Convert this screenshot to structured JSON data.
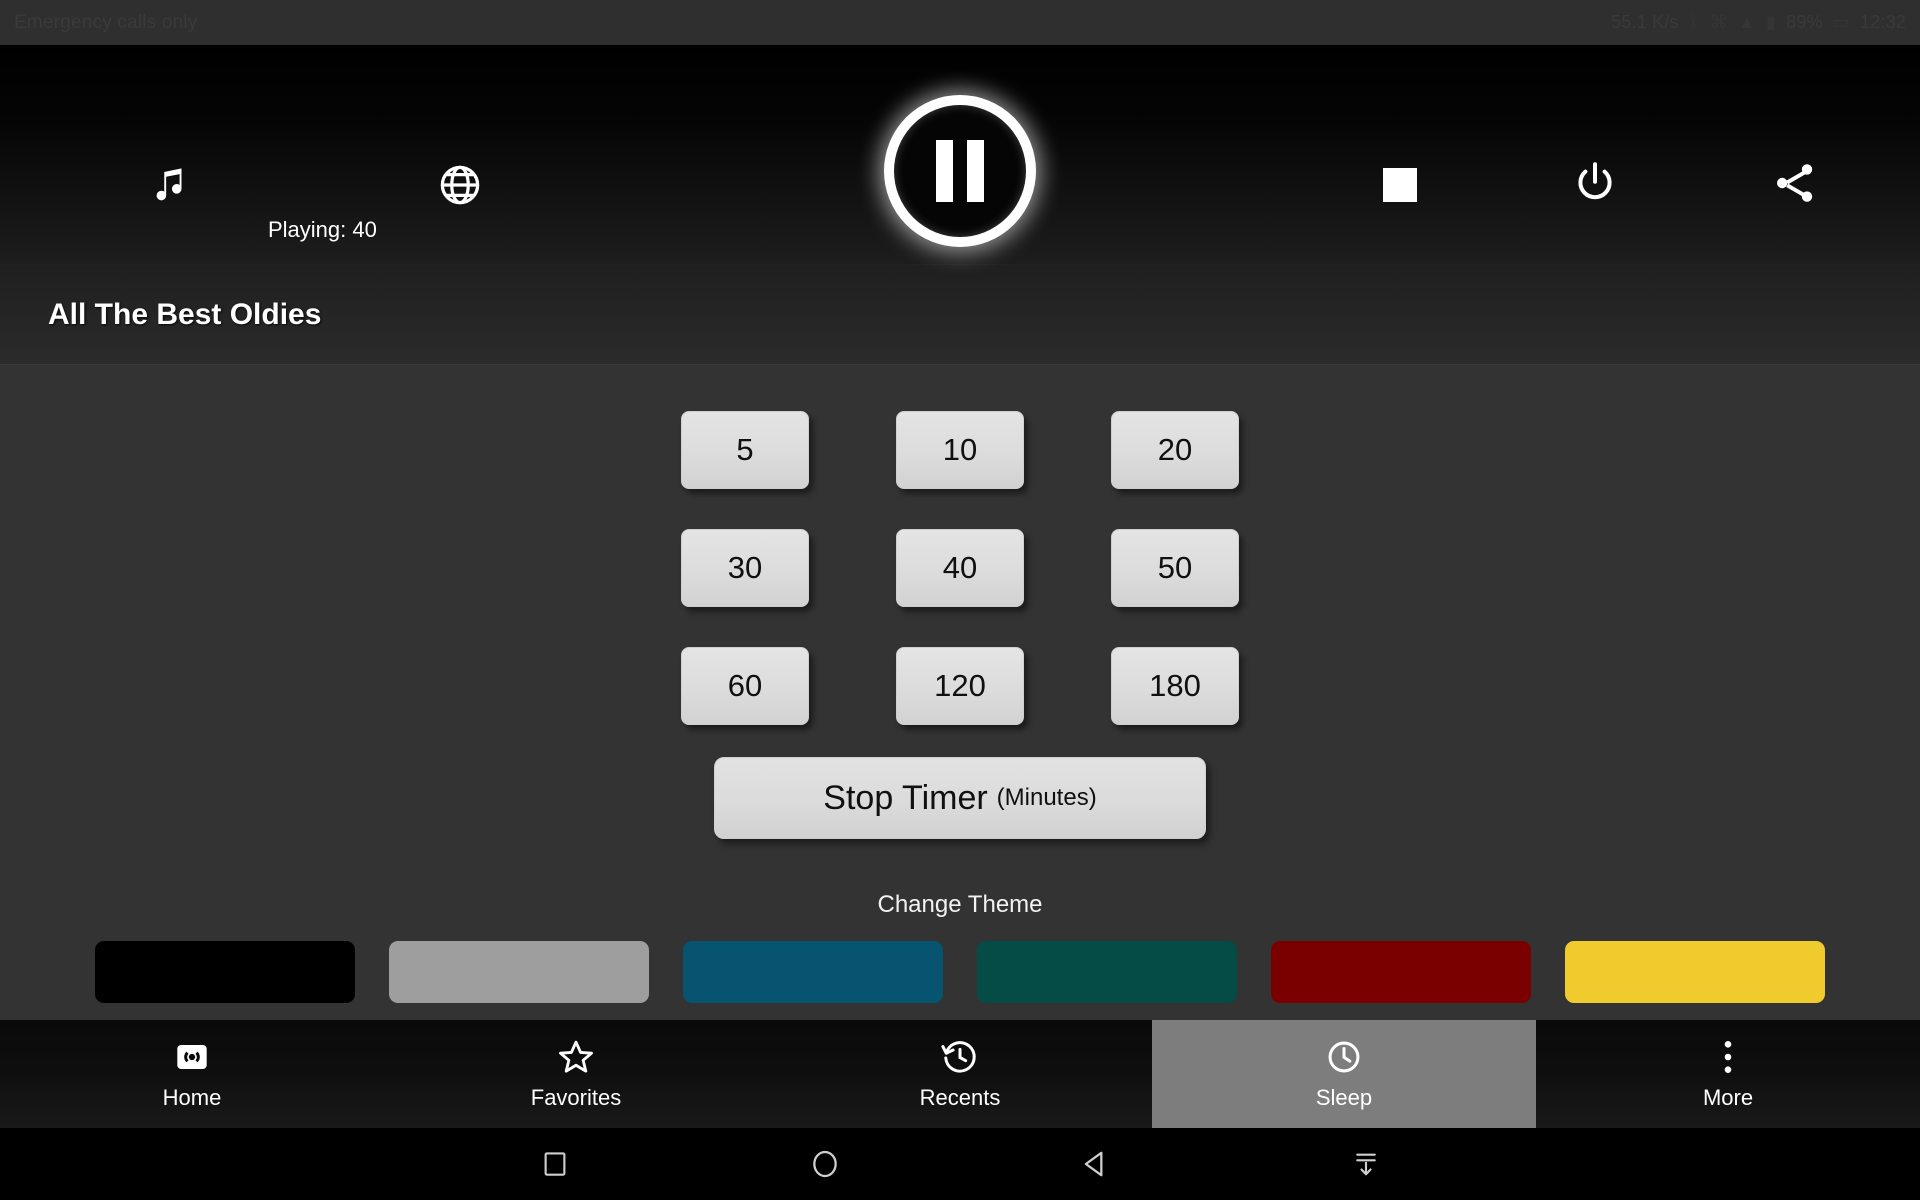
{
  "status_bar": {
    "carrier_text": "Emergency calls only",
    "network_speed": "55.1 K/s",
    "battery": "89%",
    "time": "12:32",
    "icons": [
      "bluetooth-icon",
      "vpn-icon",
      "wifi-icon",
      "signal-icon",
      "battery-icon"
    ]
  },
  "player": {
    "music_icon": "music-note-icon",
    "globe_icon": "globe-icon",
    "playing_label": "Playing: 40",
    "transport_state": "pause-icon",
    "stop_icon": "stop-square-icon",
    "power_icon": "power-icon",
    "share_icon": "share-icon",
    "station_name": "All The Best Oldies"
  },
  "sleep_timer": {
    "minutes": [
      "5",
      "10",
      "20",
      "30",
      "40",
      "50",
      "60",
      "120",
      "180"
    ],
    "stop_button_main": "Stop Timer",
    "stop_button_sub": "(Minutes)"
  },
  "theme": {
    "label": "Change Theme",
    "swatches": [
      {
        "name": "black",
        "color": "#000000"
      },
      {
        "name": "gray",
        "color": "#9e9e9e"
      },
      {
        "name": "blue",
        "color": "#075470"
      },
      {
        "name": "green",
        "color": "#044c45"
      },
      {
        "name": "red",
        "color": "#7a0000"
      },
      {
        "name": "yellow",
        "color": "#f0cb2e"
      }
    ]
  },
  "tabs": [
    {
      "label": "Home",
      "icon": "broadcast-icon",
      "selected": false
    },
    {
      "label": "Favorites",
      "icon": "star-icon",
      "selected": false
    },
    {
      "label": "Recents",
      "icon": "history-icon",
      "selected": false
    },
    {
      "label": "Sleep",
      "icon": "clock-icon",
      "selected": true
    },
    {
      "label": "More",
      "icon": "overflow-icon",
      "selected": false
    }
  ],
  "system_nav": {
    "recents": "square-icon",
    "home": "circle-icon",
    "back": "triangle-left-icon",
    "hide": "hide-navbar-icon"
  }
}
